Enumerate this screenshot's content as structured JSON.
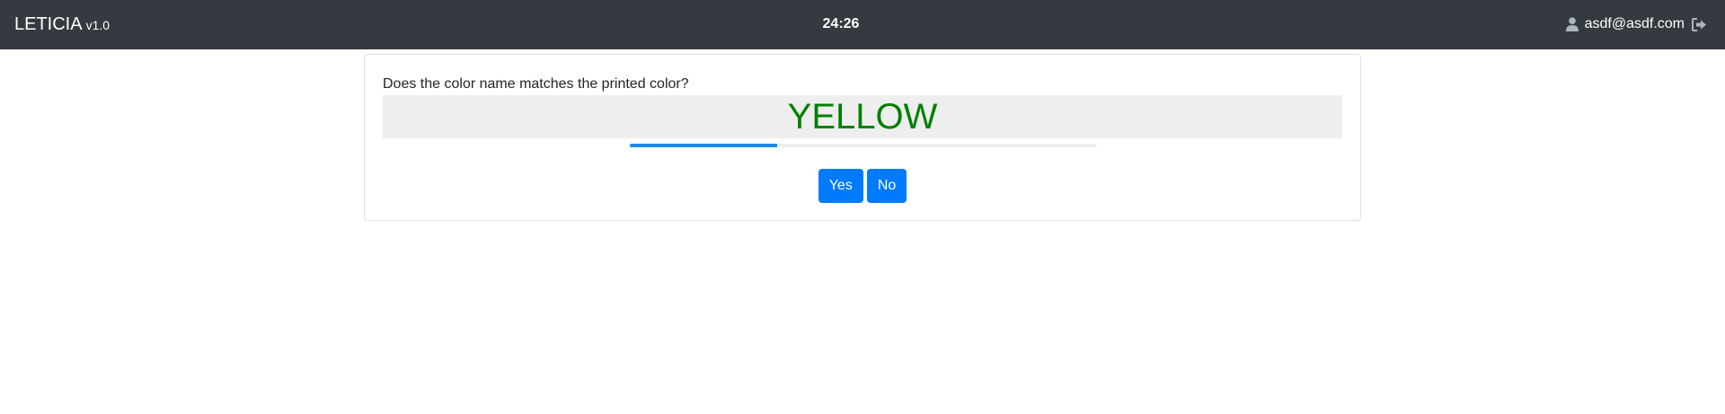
{
  "navbar": {
    "brand": "LETICIA",
    "version": "v1.0",
    "timer": "24:26",
    "user_email": "asdf@asdf.com",
    "user_icon": "user-icon",
    "logout_icon": "logout-icon"
  },
  "task": {
    "question": "Does the color name matches the printed color?",
    "word": "YELLOW",
    "word_color": "#008000",
    "progress_percent": 31.5,
    "yes_label": "Yes",
    "no_label": "No"
  },
  "colors": {
    "navbar_bg": "#343a40",
    "primary": "#007bff",
    "progress": "#1e88e5",
    "word_box_bg": "#eeeeee"
  }
}
